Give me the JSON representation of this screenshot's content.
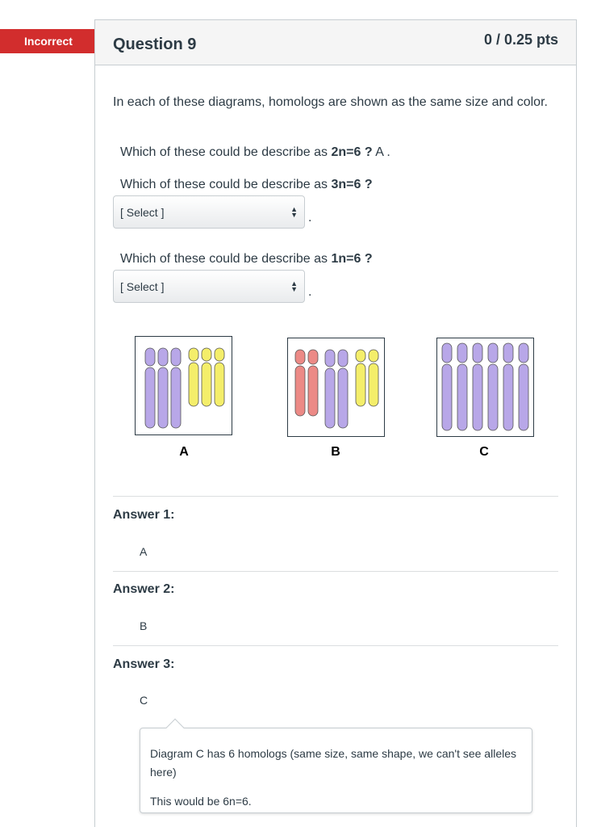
{
  "status": {
    "label": "Incorrect"
  },
  "question": {
    "title": "Question 9",
    "points": "0 / 0.25 pts",
    "text": "In each of these diagrams, homologs are shown as the same size and color.",
    "q1": {
      "prefix": "Which of these could be describe as ",
      "bold": "2n=6 ?",
      "answer": " A ."
    },
    "q2": {
      "prefix": "Which of these could be describe as ",
      "bold": "3n=6 ?",
      "select_value": "[ Select ]"
    },
    "q3": {
      "prefix": "Which of these could be describe as ",
      "bold": "1n=6 ?",
      "select_value": "[ Select ]"
    },
    "select_trailing": "."
  },
  "diagrams": [
    {
      "label": "A",
      "chromosome_colors": [
        "#b8a7e8",
        "#b8a7e8",
        "#b8a7e8",
        "#f4ee6a",
        "#f4ee6a",
        "#f4ee6a"
      ]
    },
    {
      "label": "B",
      "chromosome_colors": [
        "#ec8a86",
        "#ec8a86",
        "#b8a7e8",
        "#b8a7e8",
        "#f4ee6a",
        "#f4ee6a"
      ]
    },
    {
      "label": "C",
      "chromosome_colors": [
        "#b8a7e8",
        "#b8a7e8",
        "#b8a7e8",
        "#b8a7e8",
        "#b8a7e8",
        "#b8a7e8"
      ]
    }
  ],
  "answers": [
    {
      "label": "Answer 1:",
      "value": "A"
    },
    {
      "label": "Answer 2:",
      "value": "B"
    },
    {
      "label": "Answer 3:",
      "value": "C"
    }
  ],
  "comment": {
    "line1": "Diagram C has 6 homologs (same size, same shape, we can't see alleles here)",
    "line2": "This would be 6n=6."
  }
}
